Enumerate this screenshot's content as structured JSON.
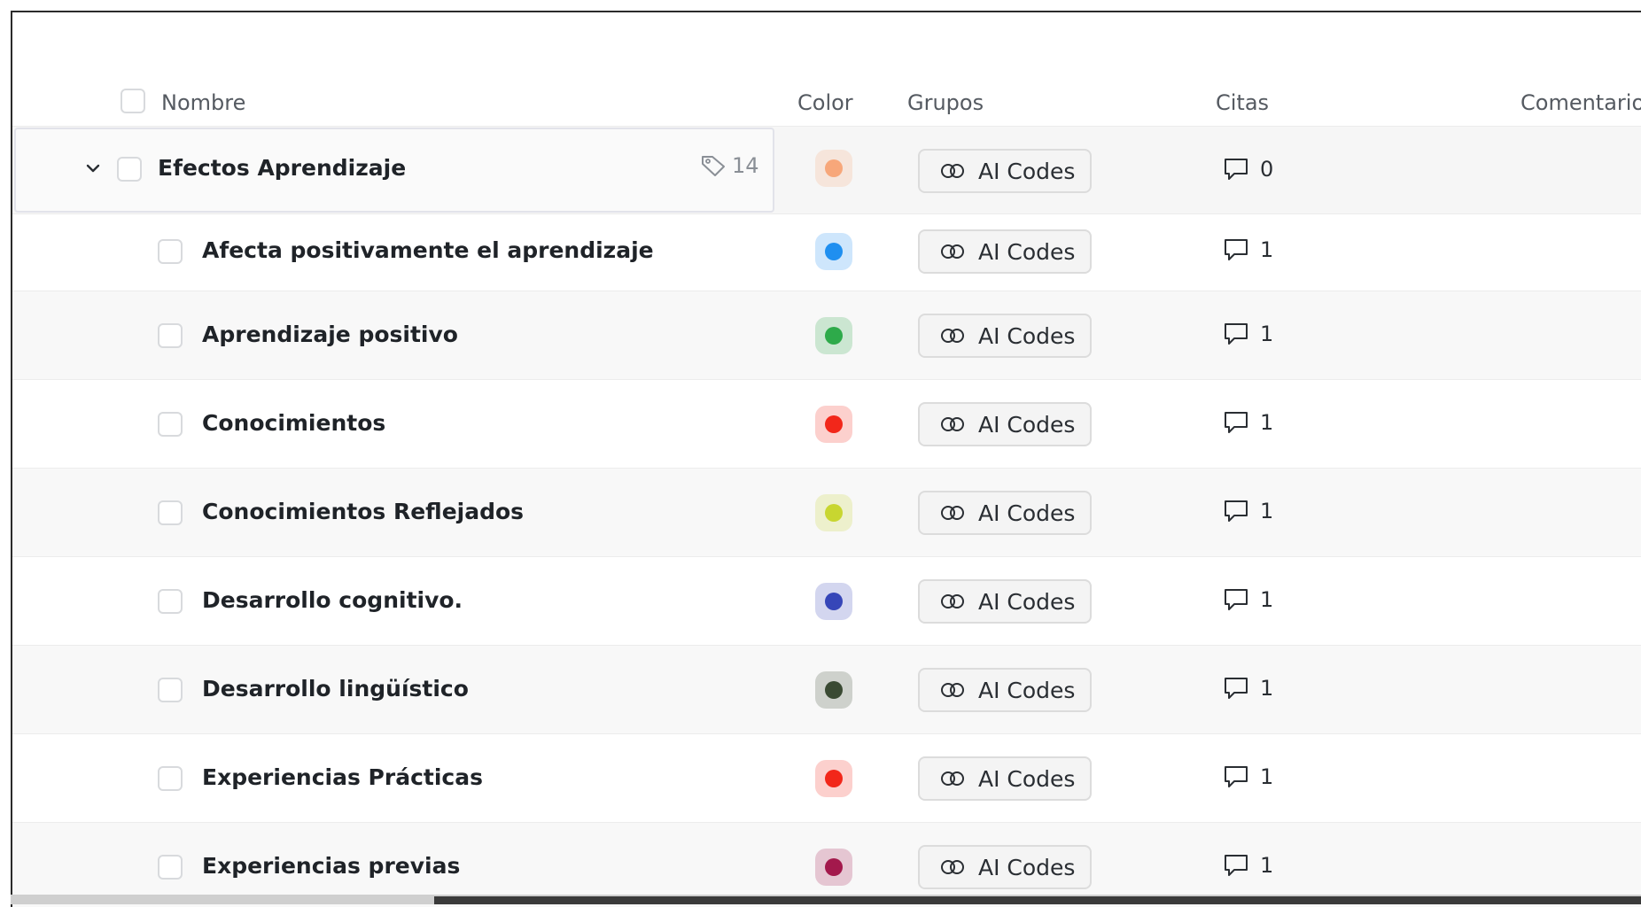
{
  "header": {
    "name": "Nombre",
    "color": "Color",
    "groups": "Grupos",
    "quotes": "Citas",
    "comments": "Comentario"
  },
  "parent": {
    "name": "Efectos Aprendizaje",
    "code_count": "14",
    "color": "#f7a77a",
    "group": "AI Codes",
    "quotes": "0"
  },
  "rows": [
    {
      "name": "Afecta positivamente el aprendizaje",
      "color": "#1f8ff0",
      "group": "AI Codes",
      "quotes": "1"
    },
    {
      "name": "Aprendizaje positivo",
      "color": "#2eaa4a",
      "group": "AI Codes",
      "quotes": "1"
    },
    {
      "name": "Conocimientos",
      "color": "#f2271a",
      "group": "AI Codes",
      "quotes": "1"
    },
    {
      "name": "Conocimientos Reflejados",
      "color": "#c8d630",
      "group": "AI Codes",
      "quotes": "1"
    },
    {
      "name": "Desarrollo cognitivo.",
      "color": "#3646b8",
      "group": "AI Codes",
      "quotes": "1"
    },
    {
      "name": "Desarrollo lingüístico",
      "color": "#3a4a33",
      "group": "AI Codes",
      "quotes": "1"
    },
    {
      "name": "Experiencias Prácticas",
      "color": "#f2271a",
      "group": "AI Codes",
      "quotes": "1"
    },
    {
      "name": "Experiencias previas",
      "color": "#a3194c",
      "group": "AI Codes",
      "quotes": "1"
    }
  ]
}
